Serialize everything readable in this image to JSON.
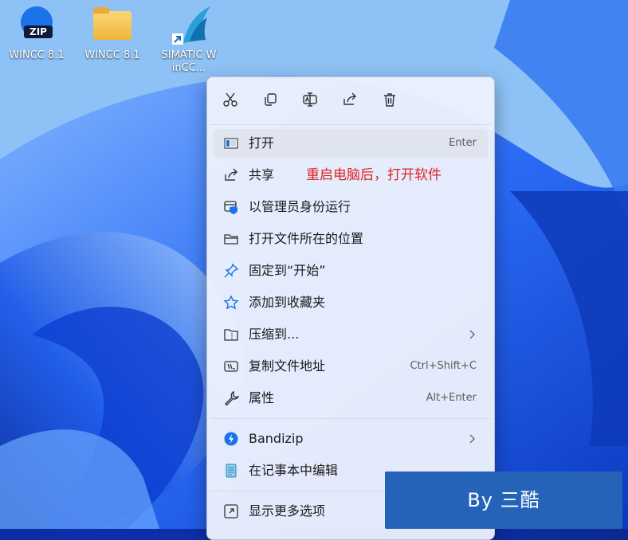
{
  "desktop": {
    "icons": [
      {
        "label": "WINCC 8.1",
        "badge": "ZIP"
      },
      {
        "label": "WINCC 8.1"
      },
      {
        "label": "SIMATIC WinCC..."
      }
    ]
  },
  "context_menu": {
    "toolbar": [
      "cut-icon",
      "copy-icon",
      "rename-icon",
      "share-icon",
      "delete-icon"
    ],
    "items": [
      {
        "label": "打开",
        "shortcut": "Enter",
        "icon": "open-icon"
      },
      {
        "label": "共享",
        "icon": "share-icon"
      },
      {
        "label": "以管理员身份运行",
        "icon": "admin-shield-icon"
      },
      {
        "label": "打开文件所在的位置",
        "icon": "folder-icon"
      },
      {
        "label": "固定到“开始”",
        "icon": "pin-icon"
      },
      {
        "label": "添加到收藏夹",
        "icon": "star-icon"
      },
      {
        "label": "压缩到...",
        "icon": "zip-folder-icon",
        "submenu": true
      },
      {
        "label": "复制文件地址",
        "shortcut": "Ctrl+Shift+C",
        "icon": "copy-path-icon"
      },
      {
        "label": "属性",
        "shortcut": "Alt+Enter",
        "icon": "wrench-icon"
      },
      {
        "label": "Bandizip",
        "icon": "bandizip-icon",
        "submenu": true
      },
      {
        "label": "在记事本中编辑",
        "icon": "notepad-icon"
      },
      {
        "label": "显示更多选项",
        "icon": "more-options-icon"
      }
    ]
  },
  "annotation": "重启电脑后，打开软件",
  "watermark": "By 三酷",
  "colors": {
    "accent": "#1a73e8",
    "annotation": "#e02222",
    "watermark_bg": "#2563b8"
  }
}
